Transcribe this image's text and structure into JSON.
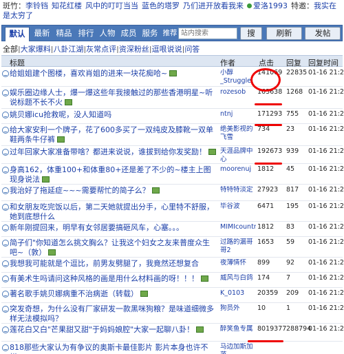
{
  "moderators": {
    "label": "斑竹：",
    "names": [
      "李铃铛",
      "知花红楼",
      "风中的叮叮当当",
      "蓝色的塔罗",
      "乃们进开放看我来",
      "爱洛1993"
    ],
    "note_label": "特邀：",
    "note_text": "我实在是太穷了"
  },
  "tabs": [
    {
      "label": "默认",
      "active": true
    },
    {
      "label": "最新",
      "active": false
    },
    {
      "label": "精品",
      "active": false
    },
    {
      "label": "排行",
      "active": false
    },
    {
      "label": "人物",
      "active": false
    },
    {
      "label": "成员",
      "active": false
    },
    {
      "label": "服务",
      "active": false
    },
    {
      "label": "推荐话题",
      "active": false
    }
  ],
  "search": {
    "placeholder": "站内搜索"
  },
  "buttons": {
    "search": "搜",
    "refresh": "刷新",
    "post": "发帖"
  },
  "categories": {
    "current": "全部",
    "items": [
      "大家爆料",
      "八卦江湖",
      "灰常点评",
      "资深粉丝",
      "逗哏说说",
      "问答"
    ]
  },
  "table_header": {
    "title": "标题",
    "author": "作者",
    "clicks": "点击",
    "replies": "回复",
    "reply_time": "回复时间"
  },
  "rows": [
    {
      "title": "给姐姐建个图楼，喜欢肖姐的进来一块花痴哈~",
      "img": true,
      "author": "小醇_Struggle",
      "clicks": "141069",
      "replies": "22835",
      "time": "01-16 21:29"
    },
    {
      "title": "娱乐圈边缘人士，爆一爆这些年我接触过的那些香港明星~听说标题不长不火",
      "img": true,
      "author": "rozesob",
      "clicks": "163638",
      "replies": "1268",
      "time": "01-16 21:29"
    },
    {
      "title": "姚贝娜icu抢救呢，没人知道吗",
      "img": false,
      "author": "ntnj",
      "clicks": "171293",
      "replies": "755",
      "time": "01-16 21:29"
    },
    {
      "title": "给大家安利一个牌子，花了600多买了一双纯皮及膝靴一双单鞋两条牛仔裤",
      "img": true,
      "author": "绝美影视的飞雪",
      "clicks": "734",
      "replies": "23",
      "time": "01-16 21:29"
    },
    {
      "title": "过年回家大家准备带啥？都进来说说，谁拔到给你发奖励！",
      "img": true,
      "author": "天涯品牌中心",
      "clicks": "192673",
      "replies": "939",
      "time": "01-16 21:29"
    },
    {
      "title": "身高162，体重100+和体重80+还是差了不少的~楼主上图现身说法",
      "img": true,
      "author": "moorenuj",
      "clicks": "1812",
      "replies": "45",
      "time": "01-16 21:29"
    },
    {
      "title": "我治好了拖延症~~~需要帮忙的简子么？",
      "img": true,
      "author": "特特特淡定",
      "clicks": "27923",
      "replies": "817",
      "time": "01-16 21:29"
    },
    {
      "title": "和女朋友吃完饭以后，第二天她就提出分手，心里特不舒服，她到底想什么",
      "img": false,
      "author": "毕谷波",
      "clicks": "6471",
      "replies": "195",
      "time": "01-16 21:29"
    },
    {
      "title": "新年刚提回来，明早有女邻居要搞砸风车，心塞。。。",
      "img": false,
      "author": "MIMIcountry",
      "clicks": "1812",
      "replies": "83",
      "time": "01-16 21:29"
    },
    {
      "title": "简子们\"你知道怎么挑文胸么？让我这个妇女之友来普度众生吧~（敦）",
      "img": true,
      "author": "过路的漏哥哥2",
      "clicks": "1653",
      "replies": "59",
      "time": "01-16 21:29"
    },
    {
      "title": "我想我可能就是个逗比，前男友劈腿了，我竟然还想复合",
      "img": false,
      "author": "夜薄情怀",
      "clicks": "899",
      "replies": "92",
      "time": "01-16 21:29"
    },
    {
      "title": "有美术生吗请问这种风格的画是用什么材料画的呀！！！",
      "img": true,
      "author": "威风与白鸽",
      "clicks": "174",
      "replies": "7",
      "time": "01-16 21:29"
    },
    {
      "title": "著名歌手姚贝娜病重不治病逝（转载）",
      "img": true,
      "author": "K_0103",
      "clicks": "20359",
      "replies": "209",
      "time": "01-16 21:29"
    },
    {
      "title": "突发奇想，为什么没有厂家研发一款黑咪狗粮？是味道细微多样无法模拟吗？",
      "img": false,
      "author": "狗员外",
      "clicks": "10",
      "replies": "1",
      "time": "01-16 21:29"
    },
    {
      "title": "莲花白又白\"芒果甜又甜\"于妈妈娘腔\"大家一起聊八卦！",
      "img": true,
      "author": "醉笑鱼专属",
      "clicks": "8019377",
      "replies": "288794",
      "time": "01-16 21:29"
    },
    {
      "title": "818那些大家认为有争议的奥斯卡最佳影片 影片本身也许不烂，",
      "img": false,
      "author": "马边加斯加落",
      "clicks": "",
      "replies": "",
      "time": ""
    }
  ]
}
